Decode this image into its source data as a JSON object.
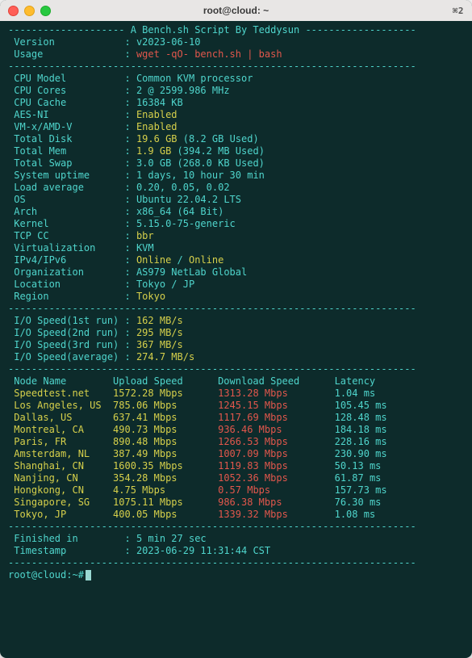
{
  "window": {
    "title": "root@cloud: ~",
    "shortcut": "⌘2"
  },
  "header": {
    "banner_left": "-------------------- ",
    "banner_text": "A Bench.sh Script By Teddysun",
    "banner_right": " -------------------"
  },
  "meta": [
    {
      "label": "Version",
      "value": "v2023-06-10",
      "color": "teal"
    },
    {
      "label": "Usage",
      "value": "wget -qO- bench.sh | bash",
      "color": "red"
    }
  ],
  "sys": [
    {
      "label": "CPU Model",
      "value": "Common KVM processor",
      "color": "teal"
    },
    {
      "label": "CPU Cores",
      "value": "2 @ 2599.986 MHz",
      "color": "teal"
    },
    {
      "label": "CPU Cache",
      "value": "16384 KB",
      "color": "teal"
    },
    {
      "label": "AES-NI",
      "value": "Enabled",
      "color": "yel"
    },
    {
      "label": "VM-x/AMD-V",
      "value": "Enabled",
      "color": "yel"
    }
  ],
  "disk": {
    "label": "Total Disk",
    "value": "19.6 GB",
    "used": "(8.2 GB Used)"
  },
  "mem": {
    "label": "Total Mem",
    "value": "1.9 GB",
    "used": "(394.2 MB Used)"
  },
  "sys2": [
    {
      "label": "Total Swap",
      "value": "3.0 GB (268.0 KB Used)",
      "color": "teal"
    },
    {
      "label": "System uptime",
      "value": "1 days, 10 hour 30 min",
      "color": "teal"
    },
    {
      "label": "Load average",
      "value": "0.20, 0.05, 0.02",
      "color": "teal"
    },
    {
      "label": "OS",
      "value": "Ubuntu 22.04.2 LTS",
      "color": "teal"
    },
    {
      "label": "Arch",
      "value": "x86_64 (64 Bit)",
      "color": "teal"
    },
    {
      "label": "Kernel",
      "value": "5.15.0-75-generic",
      "color": "teal"
    },
    {
      "label": "TCP CC",
      "value": "bbr",
      "color": "yel"
    },
    {
      "label": "Virtualization",
      "value": "KVM",
      "color": "teal"
    }
  ],
  "ipv": {
    "label": "IPv4/IPv6",
    "v4": "Online",
    "sep": " / ",
    "v6": "Online"
  },
  "sys3": [
    {
      "label": "Organization",
      "value": "AS979 NetLab Global",
      "color": "teal"
    },
    {
      "label": "Location",
      "value": "Tokyo / JP",
      "color": "teal"
    },
    {
      "label": "Region",
      "value": "Tokyo",
      "color": "yel"
    }
  ],
  "io": [
    {
      "label": "I/O Speed(1st run)",
      "value": "162 MB/s"
    },
    {
      "label": "I/O Speed(2nd run)",
      "value": "295 MB/s"
    },
    {
      "label": "I/O Speed(3rd run)",
      "value": "367 MB/s"
    },
    {
      "label": "I/O Speed(average)",
      "value": "274.7 MB/s"
    }
  ],
  "net_header": {
    "node": "Node Name",
    "up": "Upload Speed",
    "down": "Download Speed",
    "lat": "Latency"
  },
  "net": [
    {
      "node": "Speedtest.net",
      "up": "1572.28 Mbps",
      "down": "1313.28 Mbps",
      "lat": "1.04 ms"
    },
    {
      "node": "Los Angeles, US",
      "up": "785.06 Mbps",
      "down": "1245.15 Mbps",
      "lat": "105.45 ms"
    },
    {
      "node": "Dallas, US",
      "up": "637.41 Mbps",
      "down": "1117.69 Mbps",
      "lat": "128.48 ms"
    },
    {
      "node": "Montreal, CA",
      "up": "490.73 Mbps",
      "down": "936.46 Mbps",
      "lat": "184.18 ms"
    },
    {
      "node": "Paris, FR",
      "up": "890.48 Mbps",
      "down": "1266.53 Mbps",
      "lat": "228.16 ms"
    },
    {
      "node": "Amsterdam, NL",
      "up": "387.49 Mbps",
      "down": "1007.09 Mbps",
      "lat": "230.90 ms"
    },
    {
      "node": "Shanghai, CN",
      "up": "1600.35 Mbps",
      "down": "1119.83 Mbps",
      "lat": "50.13 ms"
    },
    {
      "node": "Nanjing, CN",
      "up": "354.28 Mbps",
      "down": "1052.36 Mbps",
      "lat": "61.87 ms"
    },
    {
      "node": "Hongkong, CN",
      "up": "4.75 Mbps",
      "down": "0.57 Mbps",
      "lat": "157.73 ms"
    },
    {
      "node": "Singapore, SG",
      "up": "1075.11 Mbps",
      "down": "986.38 Mbps",
      "lat": "76.30 ms"
    },
    {
      "node": "Tokyo, JP",
      "up": "400.05 Mbps",
      "down": "1339.32 Mbps",
      "lat": "1.08 ms"
    }
  ],
  "footer": [
    {
      "label": "Finished in",
      "value": "5 min 27 sec"
    },
    {
      "label": "Timestamp",
      "value": "2023-06-29 11:31:44 CST"
    }
  ],
  "sep_line": "----------------------------------------------------------------------",
  "prompt": "root@cloud:~# "
}
